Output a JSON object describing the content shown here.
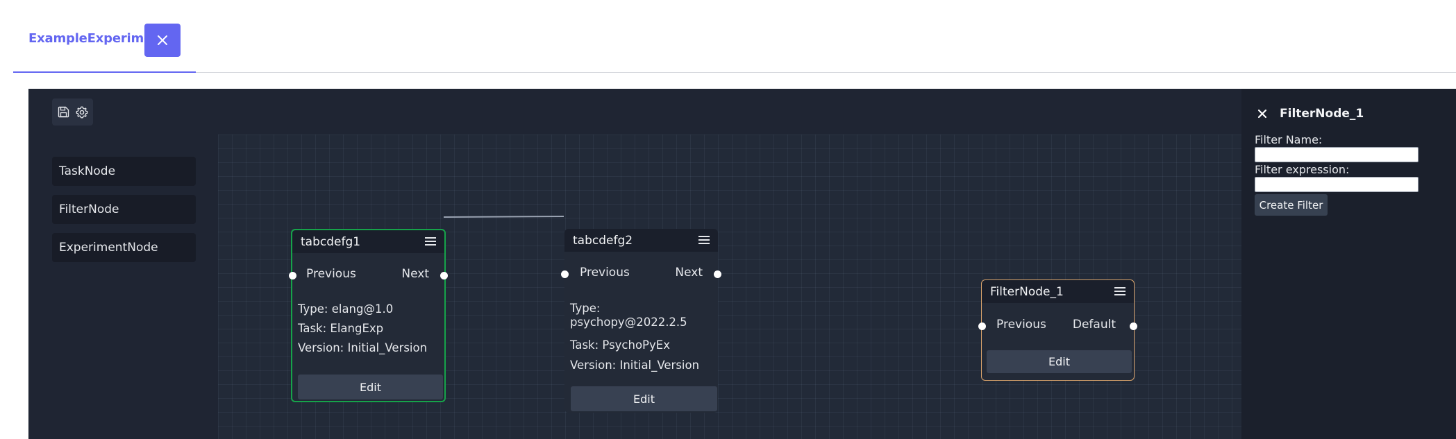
{
  "tab": {
    "title": "ExampleExperiment",
    "close_icon": "close-icon",
    "accent": "#6366f1"
  },
  "toolbar": {
    "save_icon": "save-icon",
    "settings_icon": "gear-icon"
  },
  "palette": {
    "items": [
      "TaskNode",
      "FilterNode",
      "ExperimentNode"
    ]
  },
  "nodes": [
    {
      "title": "tabcdefg1",
      "in_port": "Previous",
      "out_port": "Next",
      "type": "Type: elang@1.0",
      "task": "Task: ElangExp",
      "version": "Version: Initial_Version",
      "edit": "Edit",
      "border_color": "#16a34a"
    },
    {
      "title": "tabcdefg2",
      "in_port": "Previous",
      "out_port": "Next",
      "type": "Type: psychopy@2022.2.5",
      "task": "Task: PsychoPyEx",
      "version": "Version: Initial_Version",
      "edit": "Edit"
    },
    {
      "title": "FilterNode_1",
      "in_port": "Previous",
      "out_port": "Default",
      "edit": "Edit",
      "border_color": "#d7a26b"
    }
  ],
  "side_panel": {
    "title": "FilterNode_1",
    "filter_name_label": "Filter Name:",
    "filter_name_value": "",
    "filter_expression_label": "Filter expression:",
    "filter_expression_value": "",
    "create_button": "Create Filter"
  }
}
